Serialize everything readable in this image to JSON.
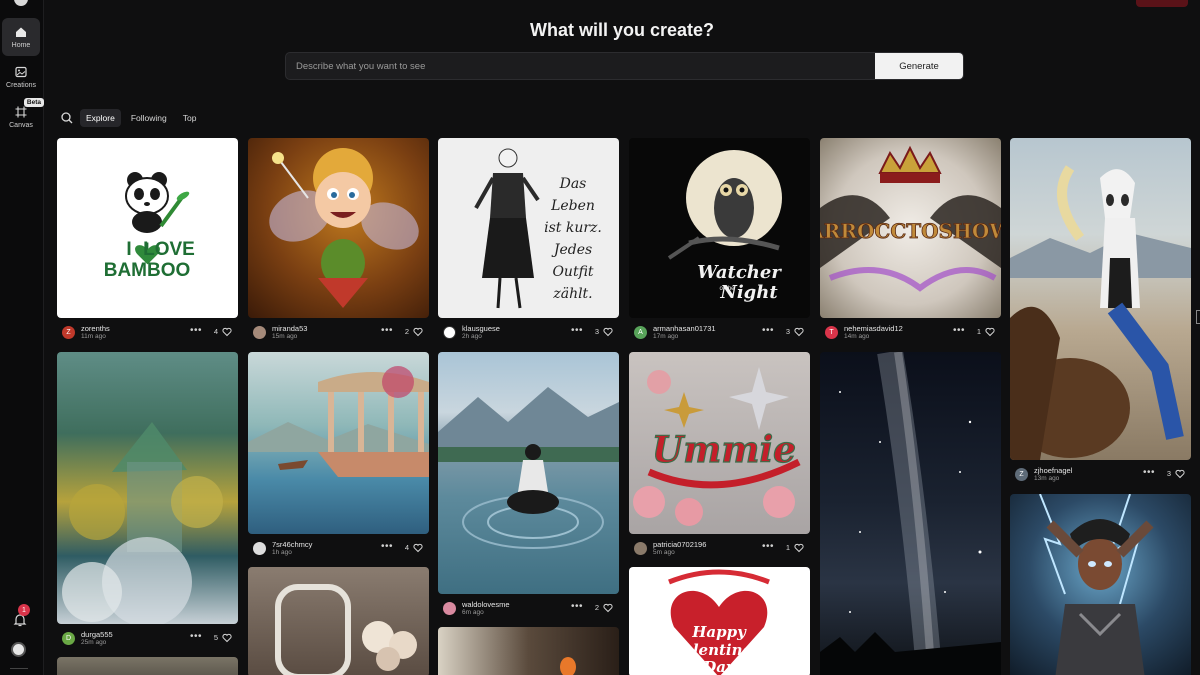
{
  "sidebar": {
    "items": [
      {
        "label": "Home",
        "icon": "home-icon"
      },
      {
        "label": "Creations",
        "icon": "image-icon"
      },
      {
        "label": "Canvas",
        "icon": "canvas-icon",
        "badge": "Beta"
      }
    ],
    "notifications": "1"
  },
  "header": {
    "title": "What will you create?",
    "placeholder": "Describe what you want to see",
    "generate_label": "Generate"
  },
  "tabs": [
    "Explore",
    "Following",
    "Top"
  ],
  "colors": {
    "accent_red": "#d9344a",
    "bg": "#0f0f10"
  },
  "cards": [
    {
      "user": "zorenths",
      "time": "11m ago",
      "likes": "4",
      "initial": "Z",
      "avatar_color": "#c0392b",
      "image_text": "I LOVE BAMBOO"
    },
    {
      "user": "miranda53",
      "time": "15m ago",
      "likes": "2",
      "initial": "",
      "avatar_color": "#a58a7a",
      "image_text": ""
    },
    {
      "user": "klausguese",
      "time": "2h ago",
      "likes": "3",
      "initial": "",
      "avatar_color": "#ffffff",
      "image_text": "Das Leben ist kurz. Jedes Outfit zählt."
    },
    {
      "user": "armanhasan01731",
      "time": "17m ago",
      "likes": "3",
      "initial": "A",
      "avatar_color": "#58a35a",
      "image_text": "Watcher of the Night"
    },
    {
      "user": "nehemiasdavid12",
      "time": "14m ago",
      "likes": "1",
      "initial": "T",
      "avatar_color": "#d9344a",
      "image_text": "ARROCCTOSHOW"
    },
    {
      "user": "zjhoefnagel",
      "time": "13m ago",
      "likes": "3",
      "initial": "Z",
      "avatar_color": "#5e6b78",
      "image_text": ""
    },
    {
      "user": "durga555",
      "time": "25m ago",
      "likes": "5",
      "initial": "D",
      "avatar_color": "#6aa845",
      "image_text": ""
    },
    {
      "user": "7sr46chmcy",
      "time": "1h ago",
      "likes": "4",
      "initial": "",
      "avatar_color": "#dddddd",
      "image_text": ""
    },
    {
      "user": "waldolovesme",
      "time": "6m ago",
      "likes": "2",
      "initial": "",
      "avatar_color": "#d98aa0",
      "image_text": ""
    },
    {
      "user": "patricia0702196",
      "time": "5m ago",
      "likes": "1",
      "initial": "",
      "avatar_color": "#8a7a6a",
      "image_text": "Ummie"
    },
    {
      "user": "",
      "time": "",
      "likes": "",
      "initial": "",
      "avatar_color": "",
      "image_text": ""
    },
    {
      "user": "",
      "time": "",
      "likes": "",
      "initial": "",
      "avatar_color": "",
      "image_text": ""
    },
    {
      "user": "",
      "time": "",
      "likes": "",
      "initial": "",
      "avatar_color": "",
      "image_text": ""
    },
    {
      "user": "",
      "time": "",
      "likes": "",
      "initial": "",
      "avatar_color": "",
      "image_text": "Happy Valentine's Day"
    },
    {
      "user": "",
      "time": "",
      "likes": "",
      "initial": "",
      "avatar_color": "",
      "image_text": ""
    },
    {
      "user": "",
      "time": "",
      "likes": "",
      "initial": "",
      "avatar_color": "",
      "image_text": ""
    }
  ]
}
